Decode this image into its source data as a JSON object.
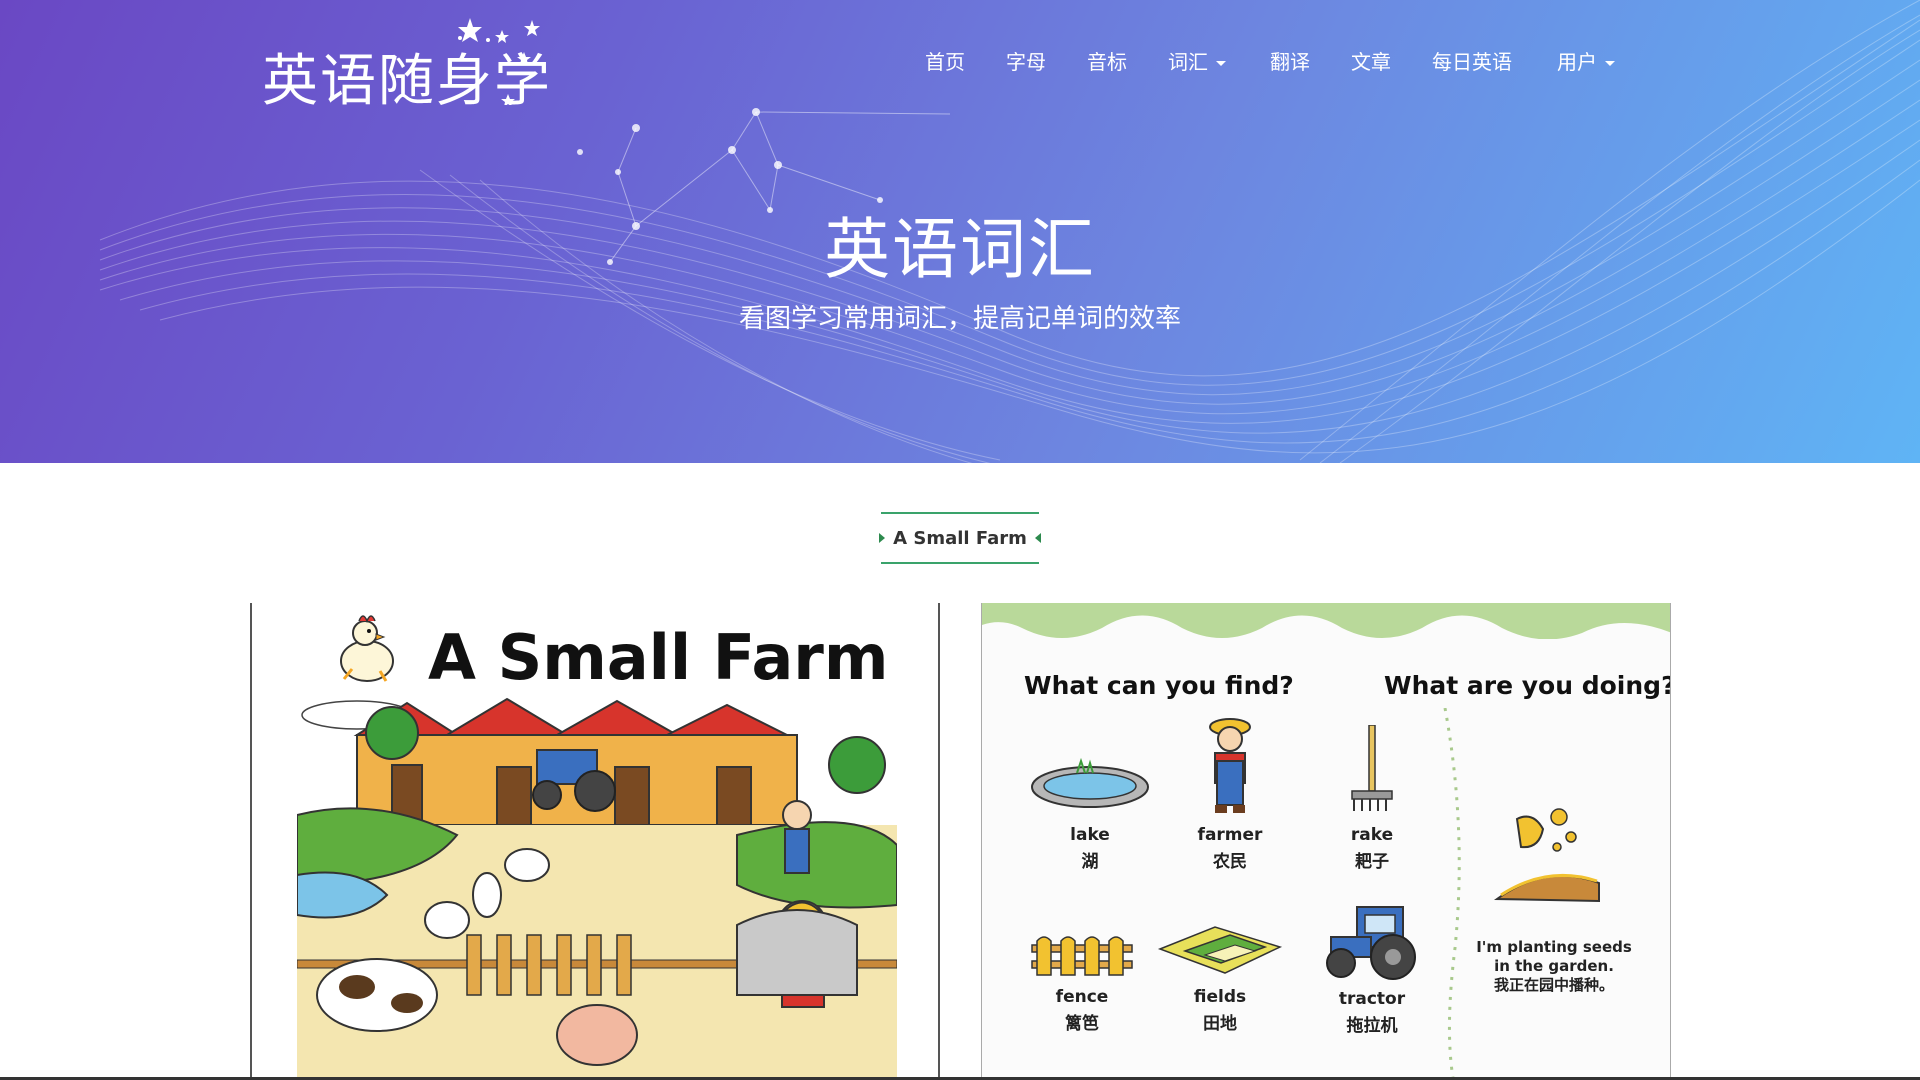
{
  "site": {
    "logo_text": "英语随身学"
  },
  "nav": {
    "items": [
      {
        "label": "首页"
      },
      {
        "label": "字母"
      },
      {
        "label": "音标"
      },
      {
        "label": "词汇"
      },
      {
        "label": "翻译"
      },
      {
        "label": "文章"
      },
      {
        "label": "每日英语"
      },
      {
        "label": "用户"
      }
    ]
  },
  "hero": {
    "title": "英语词汇",
    "subtitle": "看图学习常用词汇，提高记单词的效率"
  },
  "section": {
    "title": "A Small Farm"
  },
  "cards": {
    "left": {
      "title": "A Small Farm"
    },
    "right": {
      "question_find": "What can you find?",
      "question_doing": "What are you doing?",
      "vocab": [
        {
          "en": "lake",
          "zh": "湖"
        },
        {
          "en": "farmer",
          "zh": "农民"
        },
        {
          "en": "rake",
          "zh": "耙子"
        },
        {
          "en": "fence",
          "zh": "篱笆"
        },
        {
          "en": "fields",
          "zh": "田地"
        },
        {
          "en": "tractor",
          "zh": "拖拉机"
        }
      ],
      "doing_en_1": "I'm planting seeds",
      "doing_en_2": "in the garden.",
      "doing_zh": "我正在园中播种。"
    }
  },
  "colors": {
    "hero_start": "#6a48c4",
    "hero_end": "#5fb4f5",
    "section_accent": "#3aa36b"
  }
}
